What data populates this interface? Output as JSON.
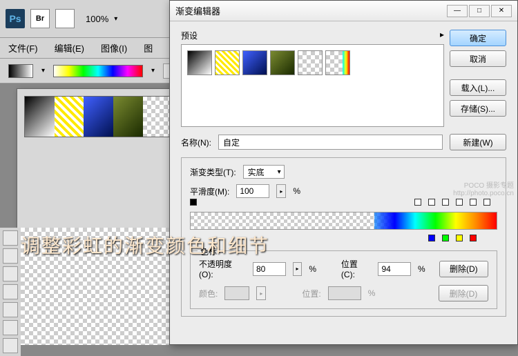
{
  "app": {
    "zoom": "100%"
  },
  "menu": {
    "file": "文件(F)",
    "edit": "编辑(E)",
    "image": "图像(I)",
    "layer": "图"
  },
  "dialog": {
    "title": "渐变编辑器",
    "presets_label": "预设",
    "ok": "确定",
    "cancel": "取消",
    "load": "载入(L)...",
    "save": "存储(S)...",
    "name_label": "名称(N):",
    "name_value": "自定",
    "new_btn": "新建(W)",
    "grad_type_label": "渐变类型(T):",
    "grad_type_value": "实底",
    "smoothness_label": "平滑度(M):",
    "smoothness_value": "100",
    "percent": "%",
    "stops_label": "色标",
    "opacity_label": "不透明度(O):",
    "opacity_value": "80",
    "position_label": "位置(C):",
    "position_value": "94",
    "delete1": "删除(D)",
    "color_label": "颜色:",
    "position2_label": "位置:",
    "delete2": "删除(D)"
  },
  "annotation": "调整彩虹的渐变颜色和细节",
  "watermark": {
    "l1": "POCO 摄影专题",
    "l2": "http://photo.poco.cn"
  }
}
